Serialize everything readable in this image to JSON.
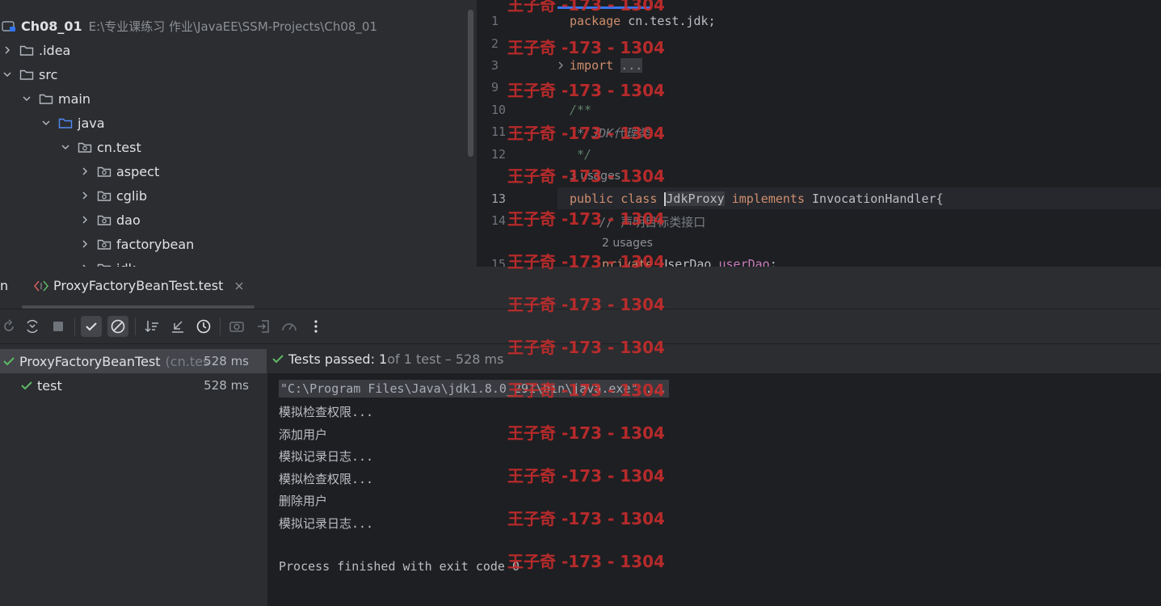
{
  "project": {
    "name": "Ch08_01",
    "path": "E:\\专业课练习 作业\\JavaEE\\SSM-Projects\\Ch08_01",
    "items": [
      {
        "label": ".idea",
        "expanded": false,
        "icon": "folder-icon"
      },
      {
        "label": "src",
        "expanded": true,
        "icon": "folder-icon"
      },
      {
        "label": "main",
        "expanded": true,
        "icon": "folder-icon"
      },
      {
        "label": "java",
        "expanded": true,
        "icon": "source-folder-icon"
      },
      {
        "label": "cn.test",
        "expanded": true,
        "icon": "package-icon"
      },
      {
        "label": "aspect",
        "expanded": false,
        "icon": "package-icon"
      },
      {
        "label": "cglib",
        "expanded": false,
        "icon": "package-icon"
      },
      {
        "label": "dao",
        "expanded": false,
        "icon": "package-icon"
      },
      {
        "label": "factorybean",
        "expanded": false,
        "icon": "package-icon"
      },
      {
        "label": "jdk",
        "expanded": false,
        "icon": "package-icon"
      }
    ]
  },
  "editor": {
    "line_numbers": [
      "1",
      "2",
      "3",
      "9",
      "10",
      "11",
      "12",
      "13",
      "14",
      "15"
    ],
    "active_line": "13",
    "code": {
      "l1_kw": "package",
      "l1_rest": " cn.test.jdk;",
      "l3_kw": "import",
      "l3_fold": "...",
      "l10": "/**",
      "l11": " * JDK代理类",
      "l12": " */",
      "hint_13": "3 usages",
      "l13_kw1": "public",
      "l13_kw2": "class",
      "l13_name": "JdkProxy",
      "l13_kw3": "implements",
      "l13_rest": " InvocationHandler{",
      "l14": "    // 声明目标类接口",
      "hint_15": "2 usages",
      "l15_kw": "private",
      "l15_type": " UserDao ",
      "l15_field": "userDao",
      "l15_end": ";"
    }
  },
  "run": {
    "tab_prev": "n",
    "tab_label": "ProxyFactoryBeanTest.test",
    "tests": [
      {
        "name": "ProxyFactoryBeanTest",
        "pkg": "(cn.tes",
        "time": "528 ms",
        "status": "passed"
      },
      {
        "name": "test",
        "pkg": "",
        "time": "528 ms",
        "status": "passed"
      }
    ],
    "summary_bold": "Tests passed: 1",
    "summary_rest": " of 1 test – 528 ms",
    "console": [
      "\"C:\\Program Files\\Java\\jdk1.8.0_291\\bin\\java.exe\" ...",
      "模拟检查权限...",
      "添加用户",
      "模拟记录日志...",
      "模拟检查权限...",
      "删除用户",
      "模拟记录日志...",
      "",
      "Process finished with exit code 0"
    ]
  },
  "watermark": "王子奇 -173 - 1304",
  "colors": {
    "accent": "#3574f0",
    "pass": "#5fb865",
    "watermark": "#c72c2c"
  }
}
